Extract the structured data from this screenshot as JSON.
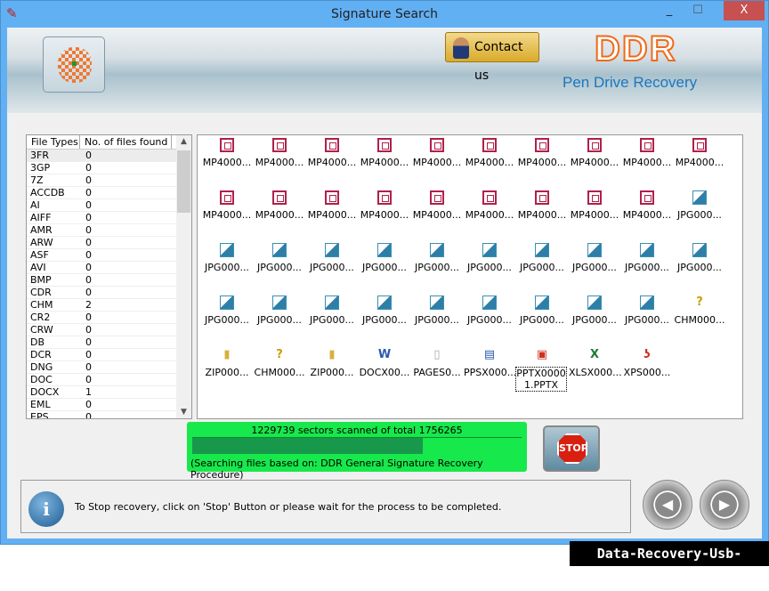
{
  "window": {
    "title": "Signature Search",
    "minimize": "_",
    "maximize": "☐",
    "close": "X"
  },
  "header": {
    "contact_label": "Contact us",
    "brand": "DDR",
    "product": "Pen Drive Recovery"
  },
  "file_types": {
    "columns": [
      "File Types",
      "No. of files found"
    ],
    "rows": [
      [
        "3FR",
        "0"
      ],
      [
        "3GP",
        "0"
      ],
      [
        "7Z",
        "0"
      ],
      [
        "ACCDB",
        "0"
      ],
      [
        "AI",
        "0"
      ],
      [
        "AIFF",
        "0"
      ],
      [
        "AMR",
        "0"
      ],
      [
        "ARW",
        "0"
      ],
      [
        "ASF",
        "0"
      ],
      [
        "AVI",
        "0"
      ],
      [
        "BMP",
        "0"
      ],
      [
        "CDR",
        "0"
      ],
      [
        "CHM",
        "2"
      ],
      [
        "CR2",
        "0"
      ],
      [
        "CRW",
        "0"
      ],
      [
        "DB",
        "0"
      ],
      [
        "DCR",
        "0"
      ],
      [
        "DNG",
        "0"
      ],
      [
        "DOC",
        "0"
      ],
      [
        "DOCX",
        "1"
      ],
      [
        "EML",
        "0"
      ],
      [
        "EPS",
        "0"
      ]
    ]
  },
  "files": [
    {
      "label": "MP4000...",
      "icon": "mp4"
    },
    {
      "label": "MP4000...",
      "icon": "mp4"
    },
    {
      "label": "MP4000...",
      "icon": "mp4"
    },
    {
      "label": "MP4000...",
      "icon": "mp4"
    },
    {
      "label": "MP4000...",
      "icon": "mp4"
    },
    {
      "label": "MP4000...",
      "icon": "mp4"
    },
    {
      "label": "MP4000...",
      "icon": "mp4"
    },
    {
      "label": "MP4000...",
      "icon": "mp4"
    },
    {
      "label": "MP4000...",
      "icon": "mp4"
    },
    {
      "label": "MP4000...",
      "icon": "mp4"
    },
    {
      "label": "MP4000...",
      "icon": "mp4"
    },
    {
      "label": "MP4000...",
      "icon": "mp4"
    },
    {
      "label": "MP4000...",
      "icon": "mp4"
    },
    {
      "label": "MP4000...",
      "icon": "mp4"
    },
    {
      "label": "MP4000...",
      "icon": "mp4"
    },
    {
      "label": "MP4000...",
      "icon": "mp4"
    },
    {
      "label": "MP4000...",
      "icon": "mp4"
    },
    {
      "label": "MP4000...",
      "icon": "mp4"
    },
    {
      "label": "MP4000...",
      "icon": "mp4"
    },
    {
      "label": "JPG000...",
      "icon": "jpg"
    },
    {
      "label": "JPG000...",
      "icon": "jpg"
    },
    {
      "label": "JPG000...",
      "icon": "jpg"
    },
    {
      "label": "JPG000...",
      "icon": "jpg"
    },
    {
      "label": "JPG000...",
      "icon": "jpg"
    },
    {
      "label": "JPG000...",
      "icon": "jpg"
    },
    {
      "label": "JPG000...",
      "icon": "jpg"
    },
    {
      "label": "JPG000...",
      "icon": "jpg"
    },
    {
      "label": "JPG000...",
      "icon": "jpg"
    },
    {
      "label": "JPG000...",
      "icon": "jpg"
    },
    {
      "label": "JPG000...",
      "icon": "jpg"
    },
    {
      "label": "JPG000...",
      "icon": "jpg"
    },
    {
      "label": "JPG000...",
      "icon": "jpg"
    },
    {
      "label": "JPG000...",
      "icon": "jpg"
    },
    {
      "label": "JPG000...",
      "icon": "jpg"
    },
    {
      "label": "JPG000...",
      "icon": "jpg"
    },
    {
      "label": "JPG000...",
      "icon": "jpg"
    },
    {
      "label": "JPG000...",
      "icon": "jpg"
    },
    {
      "label": "JPG000...",
      "icon": "jpg"
    },
    {
      "label": "JPG000...",
      "icon": "jpg"
    },
    {
      "label": "CHM000...",
      "icon": "chm"
    },
    {
      "label": "ZIP000...",
      "icon": "zip"
    },
    {
      "label": "CHM000...",
      "icon": "chm"
    },
    {
      "label": "ZIP000...",
      "icon": "zip"
    },
    {
      "label": "DOCX00...",
      "icon": "docx"
    },
    {
      "label": "PAGES0...",
      "icon": "pages"
    },
    {
      "label": "PPSX000...",
      "icon": "ppsx"
    },
    {
      "label": "PPTX00001.PPTX",
      "icon": "pptx",
      "selected": true
    },
    {
      "label": "XLSX000...",
      "icon": "xlsx"
    },
    {
      "label": "XPS000...",
      "icon": "xps"
    }
  ],
  "progress": {
    "text": "1229739 sectors scanned of total 1756265",
    "fraction": 0.7,
    "method": "(Searching files based on:  DDR General Signature Recovery Procedure)"
  },
  "stop_label": "STOP",
  "status": {
    "message": "To Stop recovery, click on 'Stop' Button or please wait for the process to be completed.",
    "info_glyph": "i"
  },
  "nav": {
    "back": "◀",
    "next": "▶"
  },
  "watermark": "Data-Recovery-Usb-Drive.com",
  "colors": {
    "progress_bg": "#17e84b",
    "progress_fill": "#18984a",
    "brand": "#f06a1a",
    "titlebar": "#62b0f4"
  }
}
